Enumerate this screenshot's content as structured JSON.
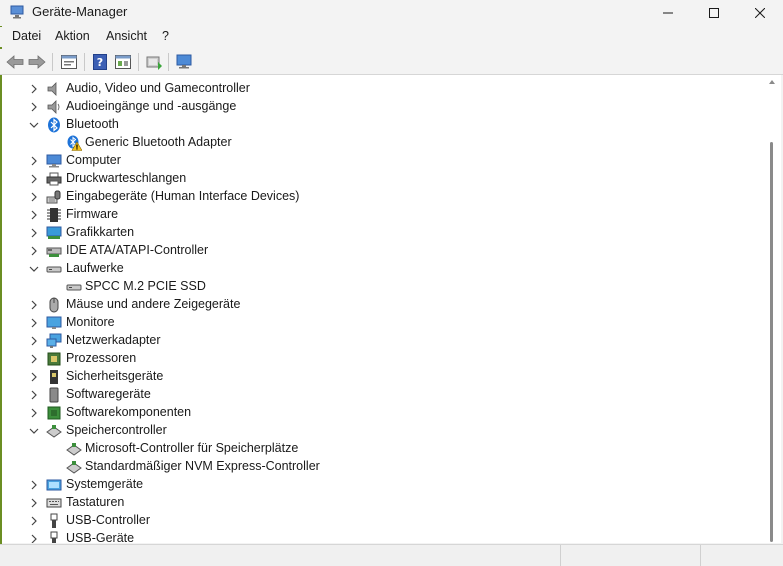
{
  "window": {
    "title": "Geräte-Manager"
  },
  "titlebar": {
    "minimize": "—",
    "maximize": "☐",
    "close": "✕"
  },
  "menu": {
    "items": [
      "Datei",
      "Aktion",
      "Ansicht",
      "?"
    ]
  },
  "toolbar": {
    "buttons": [
      "back-icon",
      "forward-icon",
      "properties-icon",
      "help-icon",
      "view-icon",
      "update-driver-icon",
      "monitor-scan-icon"
    ]
  },
  "tree": {
    "items": [
      {
        "label": "Audio, Video und Gamecontroller",
        "expanded": false,
        "level": 0,
        "icon": "speaker-icon"
      },
      {
        "label": "Audioeingänge und -ausgänge",
        "expanded": false,
        "level": 0,
        "icon": "speaker-icon"
      },
      {
        "label": "Bluetooth",
        "expanded": true,
        "level": 0,
        "icon": "bluetooth-icon"
      },
      {
        "label": "Generic Bluetooth Adapter",
        "level": 1,
        "icon": "warning-bluetooth-icon"
      },
      {
        "label": "Computer",
        "expanded": false,
        "level": 0,
        "icon": "computer-icon"
      },
      {
        "label": "Druckwarteschlangen",
        "expanded": false,
        "level": 0,
        "icon": "printer-icon"
      },
      {
        "label": "Eingabegeräte (Human Interface Devices)",
        "expanded": false,
        "level": 0,
        "icon": "hid-icon"
      },
      {
        "label": "Firmware",
        "expanded": false,
        "level": 0,
        "icon": "firmware-icon"
      },
      {
        "label": "Grafikkarten",
        "expanded": false,
        "level": 0,
        "icon": "display-adapter-icon"
      },
      {
        "label": "IDE ATA/ATAPI-Controller",
        "expanded": false,
        "level": 0,
        "icon": "ide-controller-icon"
      },
      {
        "label": "Laufwerke",
        "expanded": true,
        "level": 0,
        "icon": "drive-icon"
      },
      {
        "label": "SPCC M.2 PCIE SSD",
        "level": 1,
        "icon": "drive-icon"
      },
      {
        "label": "Mäuse und andere Zeigegeräte",
        "expanded": false,
        "level": 0,
        "icon": "mouse-icon"
      },
      {
        "label": "Monitore",
        "expanded": false,
        "level": 0,
        "icon": "monitor-icon"
      },
      {
        "label": "Netzwerkadapter",
        "expanded": false,
        "level": 0,
        "icon": "network-icon"
      },
      {
        "label": "Prozessoren",
        "expanded": false,
        "level": 0,
        "icon": "processor-icon"
      },
      {
        "label": "Sicherheitsgeräte",
        "expanded": false,
        "level": 0,
        "icon": "security-icon"
      },
      {
        "label": "Softwaregeräte",
        "expanded": false,
        "level": 0,
        "icon": "software-device-icon"
      },
      {
        "label": "Softwarekomponenten",
        "expanded": false,
        "level": 0,
        "icon": "software-component-icon"
      },
      {
        "label": "Speichercontroller",
        "expanded": true,
        "level": 0,
        "icon": "storage-controller-icon"
      },
      {
        "label": "Microsoft-Controller für Speicherplätze",
        "level": 1,
        "icon": "storage-controller-icon"
      },
      {
        "label": "Standardmäßiger NVM Express-Controller",
        "level": 1,
        "icon": "storage-controller-icon"
      },
      {
        "label": "Systemgeräte",
        "expanded": false,
        "level": 0,
        "icon": "system-device-icon"
      },
      {
        "label": "Tastaturen",
        "expanded": false,
        "level": 0,
        "icon": "keyboard-icon"
      },
      {
        "label": "USB-Controller",
        "expanded": false,
        "level": 0,
        "icon": "usb-icon"
      },
      {
        "label": "USB-Geräte",
        "expanded": false,
        "level": 0,
        "icon": "usb-icon"
      }
    ]
  }
}
